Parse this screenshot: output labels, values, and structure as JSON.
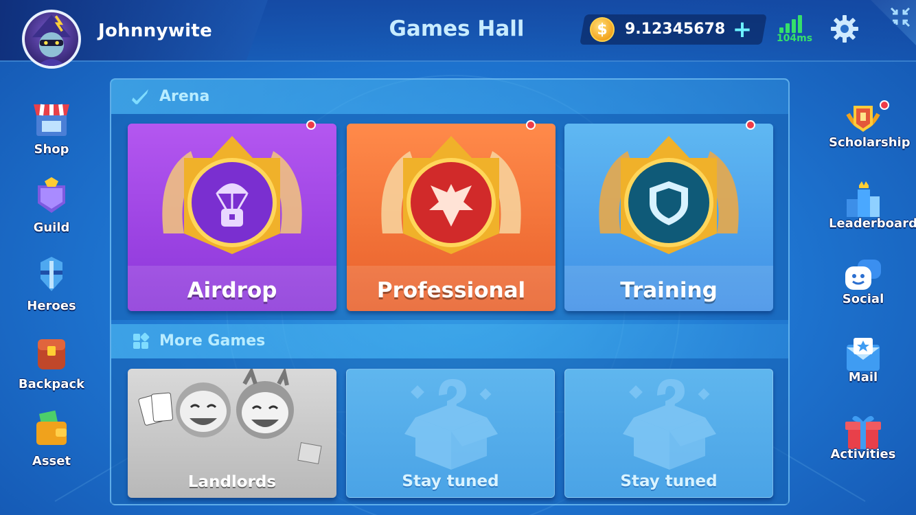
{
  "header": {
    "username": "Johnnywite",
    "title": "Games Hall",
    "balance": "9.12345678",
    "add_symbol": "+",
    "ping": "104ms",
    "coin_symbol": "$"
  },
  "left_nav": [
    {
      "label": "Shop",
      "icon": "shop-icon"
    },
    {
      "label": "Guild",
      "icon": "guild-icon"
    },
    {
      "label": "Heroes",
      "icon": "heroes-icon"
    },
    {
      "label": "Backpack",
      "icon": "backpack-icon"
    },
    {
      "label": "Asset",
      "icon": "asset-icon"
    }
  ],
  "right_nav": [
    {
      "label": "Scholarship",
      "icon": "scholarship-icon",
      "notification": true
    },
    {
      "label": "Leaderboard",
      "icon": "leaderboard-icon"
    },
    {
      "label": "Social",
      "icon": "social-icon"
    },
    {
      "label": "Mail",
      "icon": "mail-icon"
    },
    {
      "label": "Activities",
      "icon": "activities-icon"
    }
  ],
  "arena": {
    "title": "Arena",
    "cards": [
      {
        "label": "Airdrop",
        "icon": "airdrop-emblem-icon",
        "notification": true,
        "color": "#9b42e3"
      },
      {
        "label": "Professional",
        "icon": "professional-emblem-icon",
        "notification": true,
        "color": "#f07438"
      },
      {
        "label": "Training",
        "icon": "training-emblem-icon",
        "notification": true,
        "color": "#4f9fec"
      }
    ]
  },
  "more_games": {
    "title": "More Games",
    "cards": [
      {
        "label": "Landlords",
        "icon": "landlords-art",
        "disabled": true
      },
      {
        "label": "Stay tuned",
        "icon": "mystery-box-icon"
      },
      {
        "label": "Stay tuned",
        "icon": "mystery-box-icon"
      }
    ]
  },
  "colors": {
    "accent": "#6df2ff",
    "ping_green": "#35e06a",
    "notification_red": "#ee3b48",
    "title_blue": "#c8ecff"
  }
}
